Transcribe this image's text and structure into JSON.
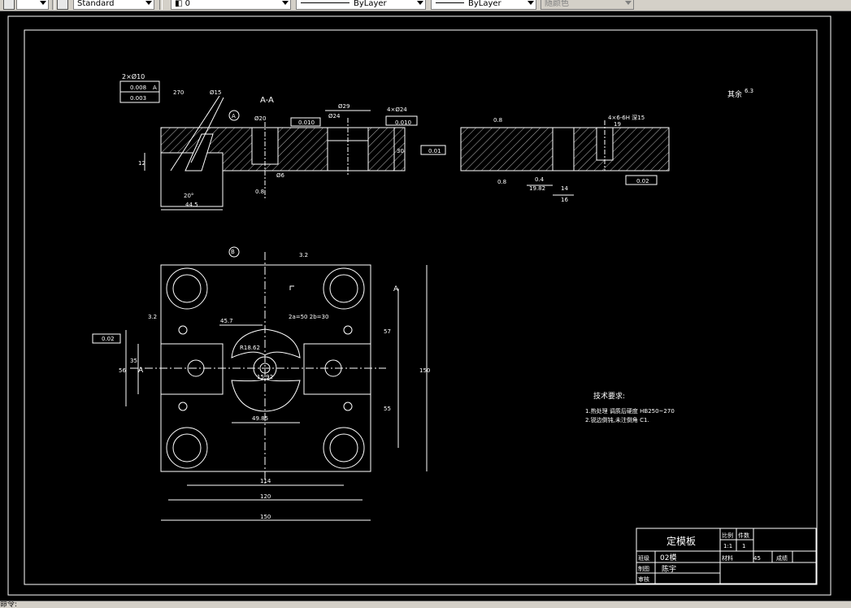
{
  "toolbar": {
    "text_style": "Standard",
    "layer": "0",
    "linetype": "ByLayer",
    "lineweight": "ByLayer",
    "color": "随颜色"
  },
  "drawing": {
    "section_label": "A-A",
    "datum_a": "A",
    "datum_b": "B",
    "label_a_left": "A",
    "label_a_right": "A",
    "note_2phi10": "2×Ø10",
    "tol_0008": "0.008",
    "tol_0003": "0.003",
    "tol_a": "A",
    "dim_29": "Ø29",
    "dim_20": "Ø20",
    "dim_24": "Ø24",
    "dim_4phi24": "4×Ø24",
    "tol_0010": "0.010",
    "dim_30": "30",
    "dim_12": "12",
    "dim_20deg": "20°",
    "dim_44_5": "44.5",
    "dim_6": "Ø6",
    "dim_15": "Ø15",
    "dim_270": "270",
    "tol_001a": "0.01",
    "dim_08": "0.8",
    "thread_note": "4×6-6H 深15",
    "dim_19": "19",
    "dim_14": "14",
    "dim_16": "16",
    "dim_04": "0.4",
    "tol_002": "0.02",
    "dim_1982": "19.82",
    "rest_note": "其余",
    "rest_val": "6.3",
    "dim_32": "3.2",
    "dim_457": "45.7",
    "dim_r1862": "R18.62",
    "note_2a": "2a=50 2b=30",
    "dim_57": "57",
    "dim_55": "55",
    "dim_150_v": "150",
    "dim_56": "56",
    "dim_35": "35",
    "dim_1592": "15.92",
    "dim_4985": "49.85",
    "dim_114": "114",
    "dim_120": "120",
    "dim_150_h": "150",
    "tol_002b": "0.02",
    "tech_title": "技术要求:",
    "tech_1": "1.热处理 调质后硬度 HB250~270",
    "tech_2": "2.锐边倒钝,未注倒角 C1."
  },
  "titleblock": {
    "part_name": "定模板",
    "scale_h": "比例",
    "qty_h": "件数",
    "scale_v": "1:1",
    "qty_v": "1",
    "mat_h": "材料",
    "mat_v": "45",
    "grade_h": "成绩",
    "row1": "班级",
    "row1v": "02模",
    "row2": "制图",
    "row2v": "陈宇",
    "row3": "审核"
  },
  "status": {
    "command": "命令:"
  }
}
